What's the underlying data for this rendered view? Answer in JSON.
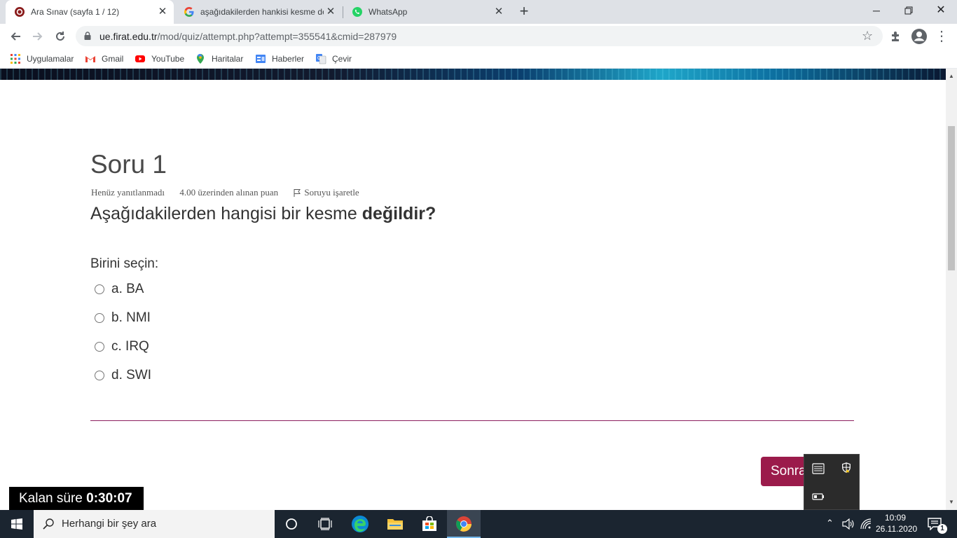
{
  "browser": {
    "tabs": [
      {
        "title": "Ara Sınav (sayfa 1 / 12)",
        "active": true
      },
      {
        "title": "aşağıdakilerden hankisi kesme de",
        "active": false
      },
      {
        "title": "WhatsApp",
        "active": false
      }
    ],
    "url_host": "ue.firat.edu.tr",
    "url_path": "/mod/quiz/attempt.php?attempt=355541&cmid=287979",
    "bookmarks": [
      "Uygulamalar",
      "Gmail",
      "YouTube",
      "Haritalar",
      "Haberler",
      "Çevir"
    ]
  },
  "quiz": {
    "question_heading": "Soru 1",
    "status": "Henüz yanıtlanmadı",
    "points": "4.00 üzerinden alınan puan",
    "flag_label": "Soruyu işaretle",
    "question_text_plain": "Aşağıdakilerden hangisi bir kesme ",
    "question_text_bold": "değildir?",
    "prompt": "Birini seçin:",
    "options": [
      {
        "label": "a. BA"
      },
      {
        "label": "b. NMI"
      },
      {
        "label": "c. IRQ"
      },
      {
        "label": "d. SWI"
      }
    ],
    "next_button": "Sonraki sayfa",
    "timer_label": "Kalan süre ",
    "timer_value": "0:30:07"
  },
  "taskbar": {
    "search_placeholder": "Herhangi bir şey ara",
    "time": "10:09",
    "date": "26.11.2020",
    "notification_count": "1"
  },
  "colors": {
    "accent": "#9b1b4b",
    "divider": "#8b1e5e",
    "taskbar": "#1b2530"
  }
}
